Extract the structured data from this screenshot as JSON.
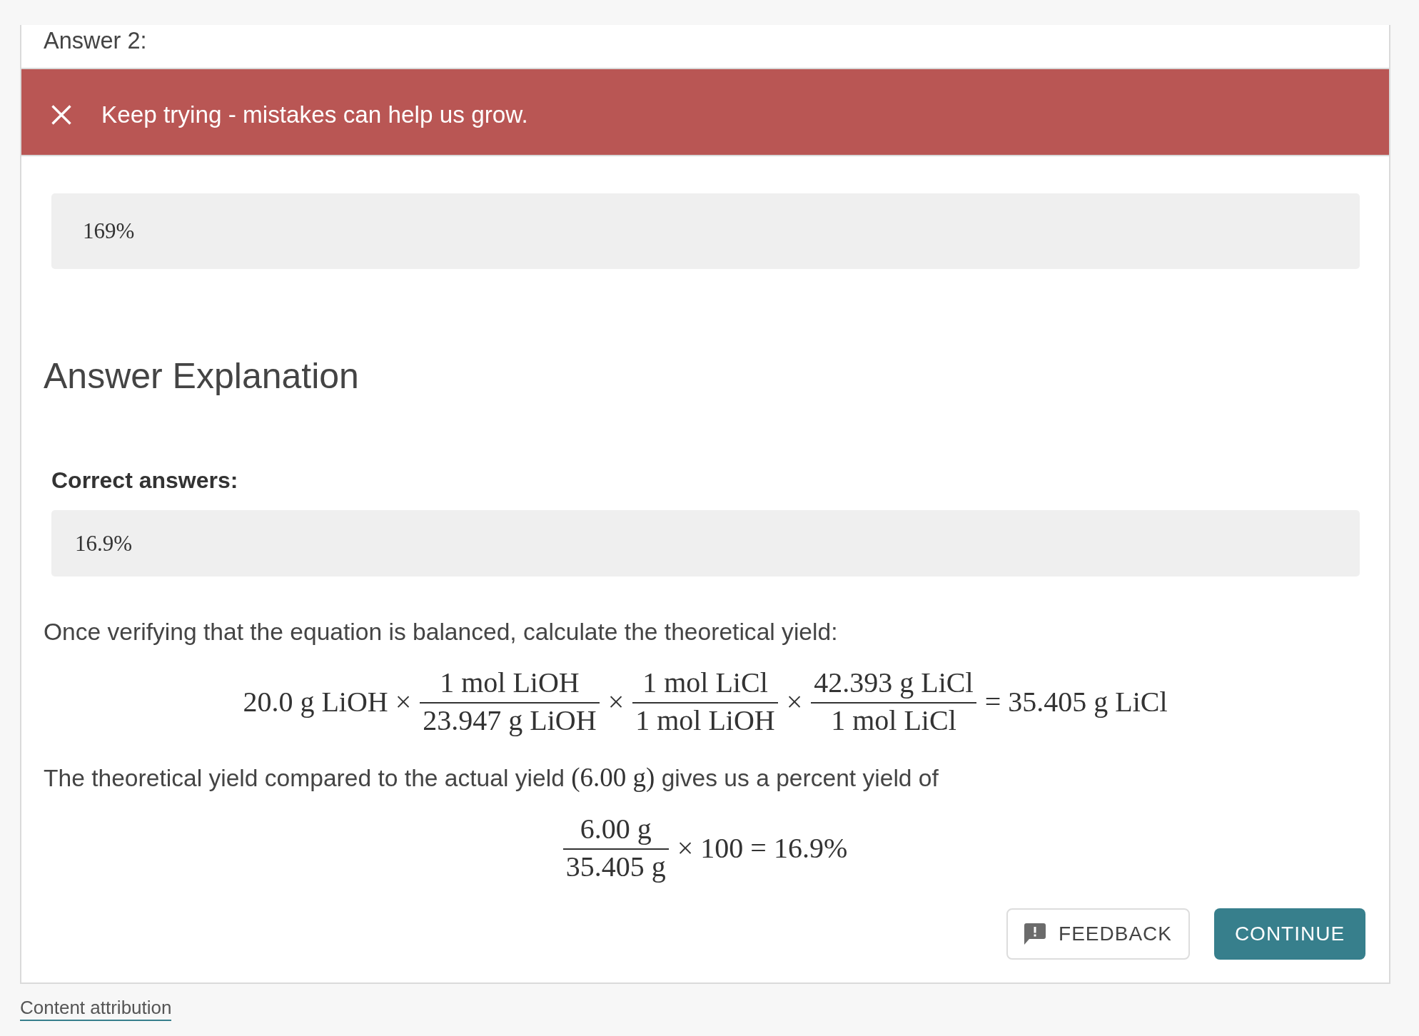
{
  "answer": {
    "label": "Answer 2:",
    "feedback": {
      "correct": false,
      "message": "Keep trying - mistakes can help us grow."
    },
    "value": "169%"
  },
  "explanation": {
    "title": "Answer Explanation",
    "correct_answers_label": "Correct answers:",
    "correct_answers": [
      "16.9%"
    ],
    "body": [
      {
        "kind": "paragraph",
        "segments": [
          {
            "kind": "text",
            "text": "Once verifying that the equation is balanced, calculate the theoretical yield:"
          }
        ]
      },
      {
        "kind": "equation",
        "terms": [
          {
            "kind": "text",
            "text": "20.0 g LiOH ×"
          },
          {
            "kind": "fraction",
            "numerator": "1 mol LiOH",
            "denominator": "23.947 g LiOH"
          },
          {
            "kind": "text",
            "text": "×"
          },
          {
            "kind": "fraction",
            "numerator": "1 mol LiCl",
            "denominator": "1 mol LiOH"
          },
          {
            "kind": "text",
            "text": "×"
          },
          {
            "kind": "fraction",
            "numerator": "42.393 g LiCl",
            "denominator": "1 mol LiCl"
          },
          {
            "kind": "text",
            "text": "= 35.405 g LiCl"
          }
        ]
      },
      {
        "kind": "paragraph",
        "segments": [
          {
            "kind": "text",
            "text": "The theoretical yield compared to the actual yield "
          },
          {
            "kind": "math",
            "text": "(6.00 g)"
          },
          {
            "kind": "text",
            "text": " gives us a percent yield of"
          }
        ]
      },
      {
        "kind": "equation",
        "terms": [
          {
            "kind": "fraction",
            "numerator": "6.00 g",
            "denominator": "35.405 g"
          },
          {
            "kind": "text",
            "text": "× 100 = 16.9%"
          }
        ]
      }
    ]
  },
  "buttons": [
    {
      "kind": "feedback",
      "label": "FEEDBACK"
    },
    {
      "kind": "continue",
      "label": "CONTINUE"
    }
  ],
  "footer_link": "Content attribution"
}
